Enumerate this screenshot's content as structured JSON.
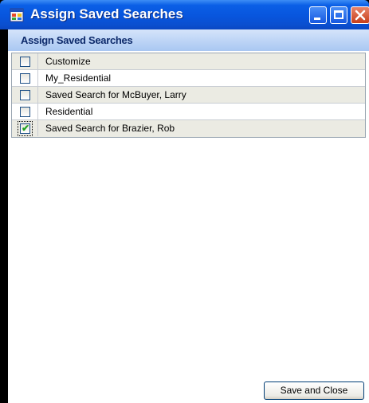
{
  "window": {
    "title": "Assign Saved Searches",
    "icon": "app-form-icon"
  },
  "header": {
    "title": "Assign Saved Searches"
  },
  "list": {
    "items": [
      {
        "label": "Customize",
        "checked": false
      },
      {
        "label": "My_Residential",
        "checked": false
      },
      {
        "label": "Saved Search for McBuyer, Larry",
        "checked": false
      },
      {
        "label": "Residential",
        "checked": false
      },
      {
        "label": "Saved Search for Brazier, Rob",
        "checked": true
      }
    ]
  },
  "footer": {
    "save_label": "Save and  Close"
  },
  "colors": {
    "titlebar": "#0855dd",
    "header_text": "#0d2a6b",
    "check": "#21a121"
  }
}
